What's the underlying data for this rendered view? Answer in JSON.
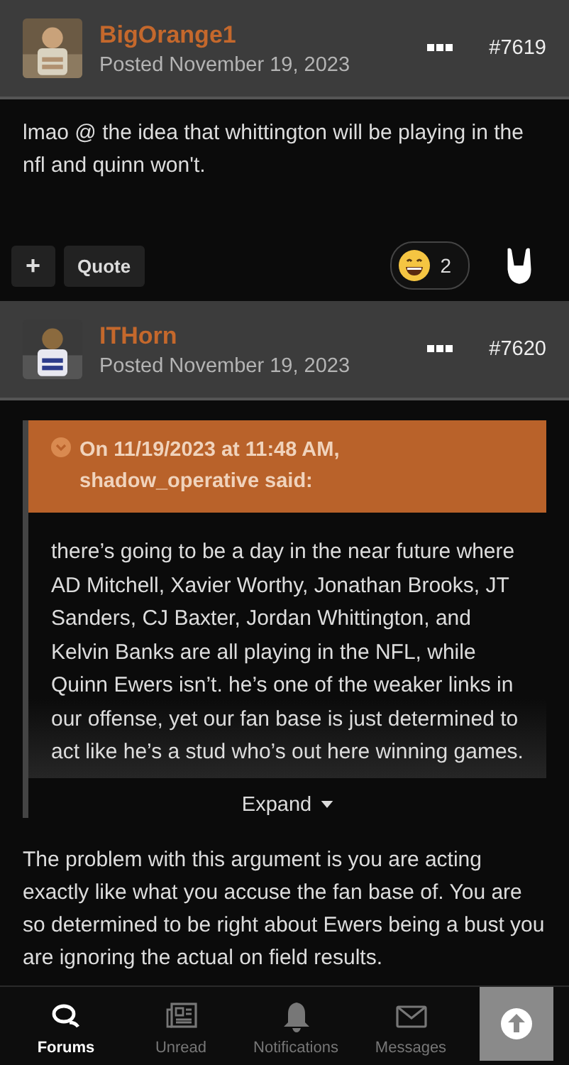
{
  "posts": [
    {
      "author": "BigOrange1",
      "posted": "Posted November 19, 2023",
      "number": "#7619",
      "body": "lmao @ the idea that whittington will be playing in the nfl and quinn won't.",
      "actions": {
        "plus": "+",
        "quote": "Quote",
        "reaction_count": "2"
      }
    },
    {
      "author": "ITHorn",
      "posted": "Posted November 19, 2023",
      "number": "#7620",
      "quote": {
        "citation": "On 11/19/2023 at 11:48 AM, shadow_operative said:",
        "text": "there’s going to be a day in the near future where AD Mitchell, Xavier Worthy, Jonathan Brooks, JT Sanders, CJ Baxter, Jordan Whittington, and Kelvin Banks are all playing in the NFL, while Quinn Ewers isn’t. he’s one of the weaker links in our offense, yet our fan base is just determined to act like he’s a stud who’s out here winning games.",
        "expand": "Expand"
      },
      "body": "The problem with this argument is you are acting exactly like what you accuse the fan base of. You are so determined to be right about Ewers being a bust you are ignoring the actual on field results."
    }
  ],
  "tabs": [
    {
      "label": "Forums",
      "kind": "forums",
      "selected": true
    },
    {
      "label": "Unread",
      "kind": "unread",
      "selected": false
    },
    {
      "label": "Notifications",
      "kind": "bell",
      "selected": false
    },
    {
      "label": "Messages",
      "kind": "mail",
      "selected": false
    }
  ]
}
